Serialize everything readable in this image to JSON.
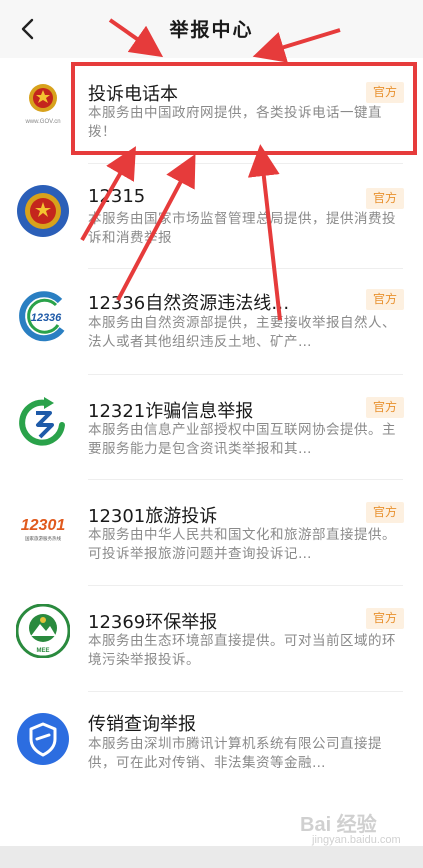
{
  "header": {
    "title": "举报中心"
  },
  "badge_label": "官方",
  "items": [
    {
      "name": "投诉电话本",
      "desc": "本服务由中国政府网提供，各类投诉电话一键直拨！",
      "logo_text": "www.GOV.cn"
    },
    {
      "name": "12315",
      "desc": "本服务由国家市场监督管理总局提供，提供消费投诉和消费举报"
    },
    {
      "name": "12336自然资源违法线…",
      "desc": "本服务由自然资源部提供，主要接收举报自然人、法人或者其他组织违反土地、矿产…",
      "logo_text": "12336"
    },
    {
      "name": "12321诈骗信息举报",
      "desc": "本服务由信息产业部授权中国互联网协会提供。主要服务能力是包含资讯类举报和其…"
    },
    {
      "name": "12301旅游投诉",
      "desc": "本服务由中华人民共和国文化和旅游部直接提供。可投诉举报旅游问题并查询投诉记…",
      "logo_text": "12301",
      "logo_sub": "国家旅游服务热线"
    },
    {
      "name": "12369环保举报",
      "desc": "本服务由生态环境部直接提供。可对当前区域的环境污染举报投诉。",
      "logo_text": "MEE"
    },
    {
      "name": "传销查询举报",
      "desc": "本服务由深圳市腾讯计算机系统有限公司直接提供，可在此对传销、非法集资等金融…"
    }
  ],
  "watermark": {
    "text": "Bai 经验",
    "sub": "jingyan.baidu.com"
  },
  "colors": {
    "highlight": "#e63b3b",
    "badge_bg": "#fdf0e0",
    "badge_text": "#e8912f"
  }
}
